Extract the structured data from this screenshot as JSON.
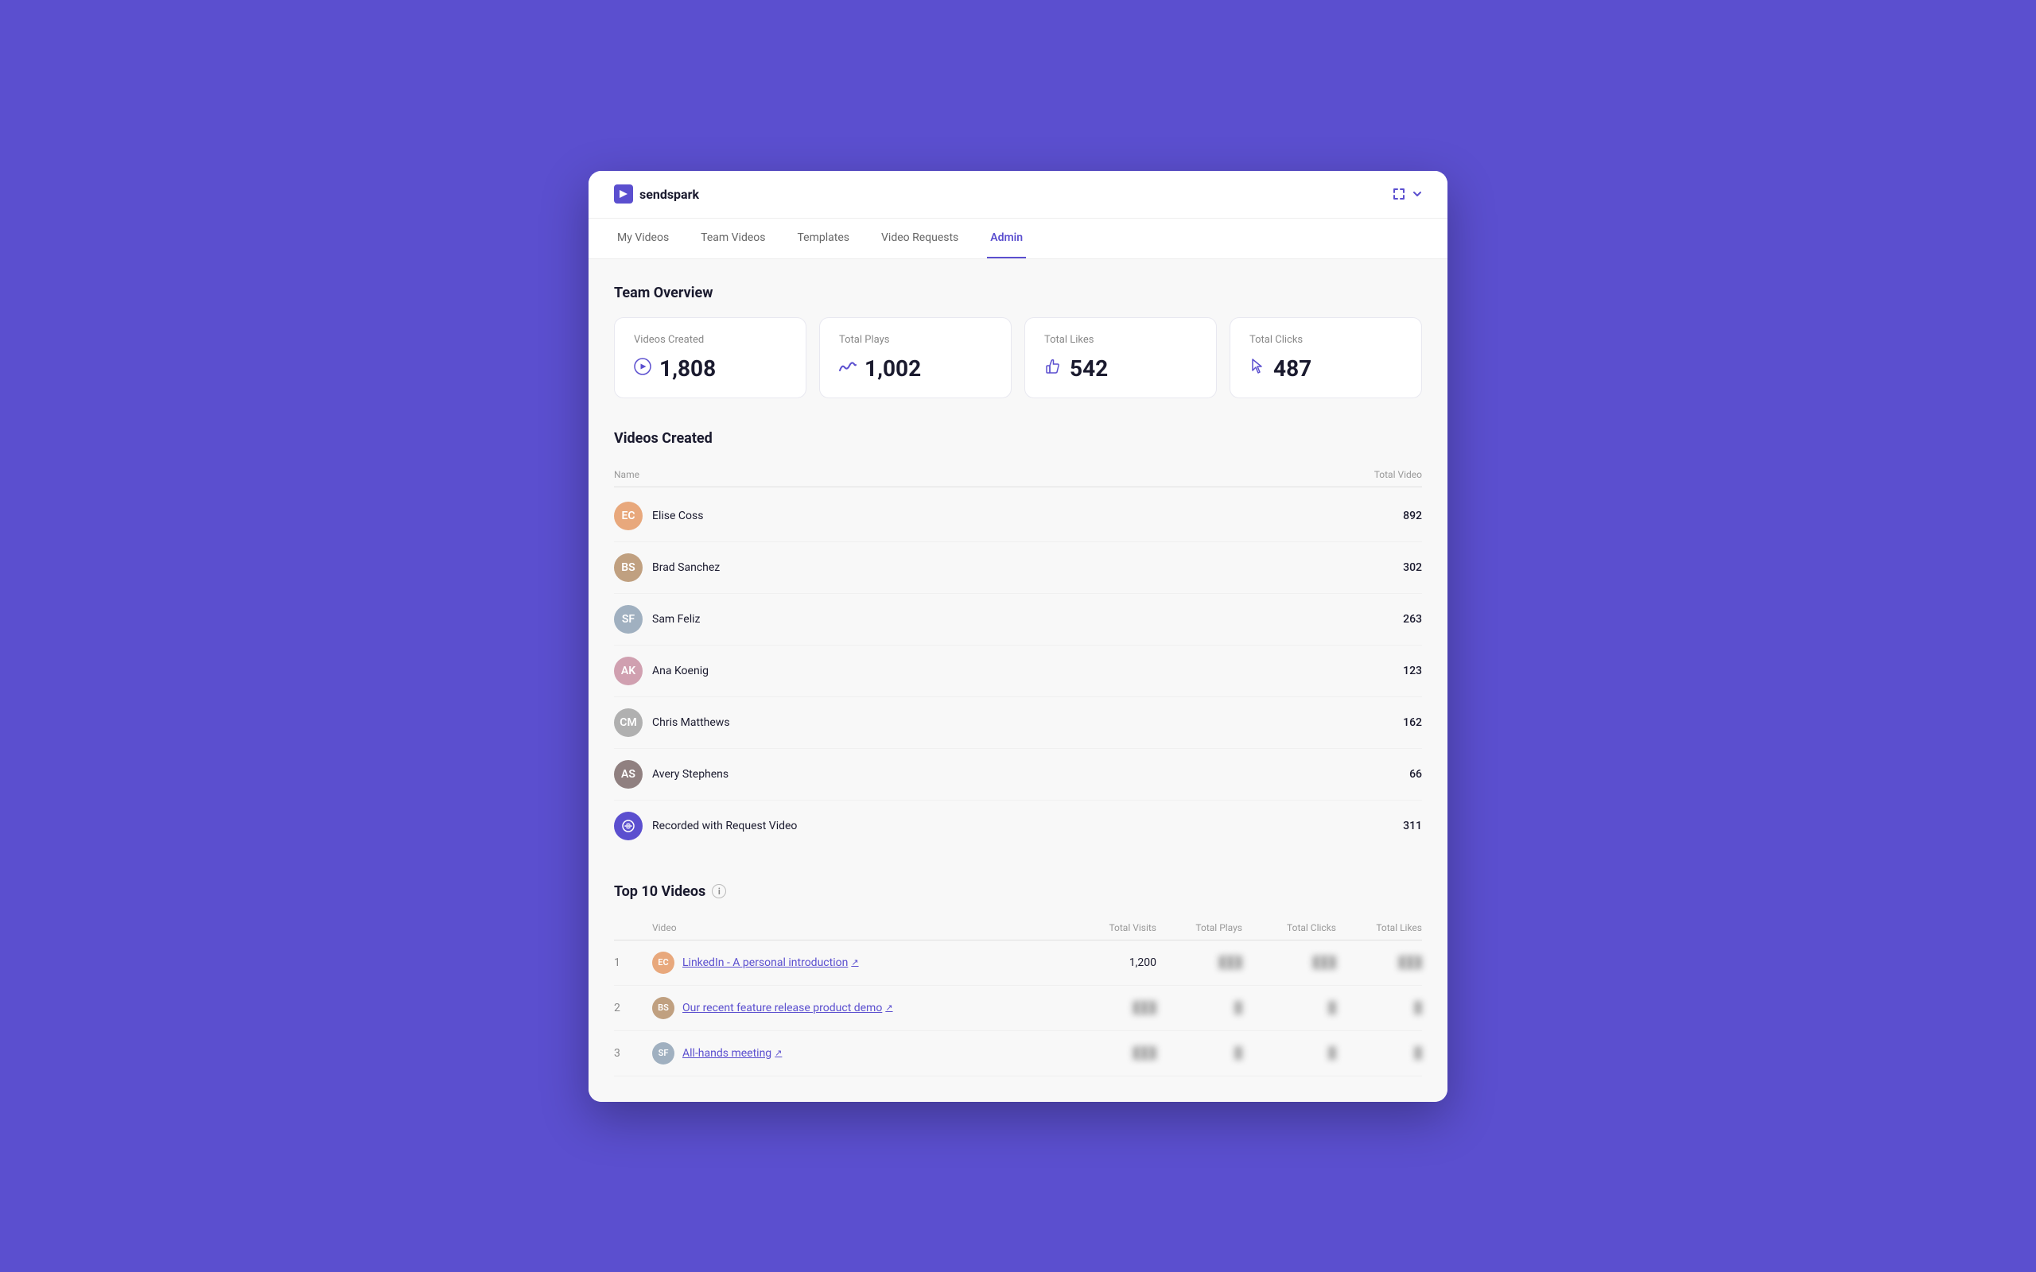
{
  "app": {
    "logo_text": "sendspark",
    "logo_icon": "S"
  },
  "nav": {
    "items": [
      {
        "label": "My Videos",
        "active": false
      },
      {
        "label": "Team Videos",
        "active": false
      },
      {
        "label": "Templates",
        "active": false
      },
      {
        "label": "Video Requests",
        "active": false
      },
      {
        "label": "Admin",
        "active": true
      }
    ]
  },
  "team_overview": {
    "title": "Team Overview",
    "stats": [
      {
        "label": "Videos Created",
        "value": "1,808",
        "icon": "▶"
      },
      {
        "label": "Total Plays",
        "value": "1,002",
        "icon": "∿"
      },
      {
        "label": "Total Likes",
        "value": "542",
        "icon": "👍"
      },
      {
        "label": "Total Clicks",
        "value": "487",
        "icon": "↖"
      }
    ]
  },
  "videos_created": {
    "title": "Videos Created",
    "columns": {
      "name": "Name",
      "total_video": "Total Video"
    },
    "rows": [
      {
        "name": "Elise Coss",
        "value": "892",
        "initials": "EC",
        "color": "av1"
      },
      {
        "name": "Brad Sanchez",
        "value": "302",
        "initials": "BS",
        "color": "av2"
      },
      {
        "name": "Sam Feliz",
        "value": "263",
        "initials": "SF",
        "color": "av3"
      },
      {
        "name": "Ana Koenig",
        "value": "123",
        "initials": "AK",
        "color": "av4"
      },
      {
        "name": "Chris Matthews",
        "value": "162",
        "initials": "CM",
        "color": "av5"
      },
      {
        "name": "Avery Stephens",
        "value": "66",
        "initials": "AS",
        "color": "av6"
      },
      {
        "name": "Recorded with Request Video",
        "value": "311",
        "initials": "🔗",
        "color": "link"
      }
    ]
  },
  "top10": {
    "title": "Top 10 Videos",
    "columns": {
      "video": "Video",
      "total_visits": "Total Visits",
      "total_plays": "Total Plays",
      "total_clicks": "Total Clicks",
      "total_likes": "Total Likes"
    },
    "rows": [
      {
        "num": "1",
        "name": "LinkedIn - A personal introduction",
        "total_visits": "1,200",
        "total_plays": "████",
        "total_clicks": "████",
        "total_likes": "████",
        "blurred_plays": true,
        "blurred_clicks": true,
        "blurred_likes": true,
        "initials": "EC",
        "color": "av1"
      },
      {
        "num": "2",
        "name": "Our recent feature release product demo",
        "total_visits": "████",
        "total_plays": "█",
        "total_clicks": "█",
        "total_likes": "█",
        "blurred_visits": true,
        "blurred_plays": true,
        "blurred_clicks": true,
        "blurred_likes": true,
        "initials": "BS",
        "color": "av2"
      },
      {
        "num": "3",
        "name": "All-hands meeting",
        "total_visits": "███",
        "total_plays": "█",
        "total_clicks": "█",
        "total_likes": "█",
        "blurred_visits": true,
        "blurred_plays": true,
        "blurred_clicks": true,
        "blurred_likes": true,
        "initials": "SF",
        "color": "av3"
      }
    ]
  }
}
